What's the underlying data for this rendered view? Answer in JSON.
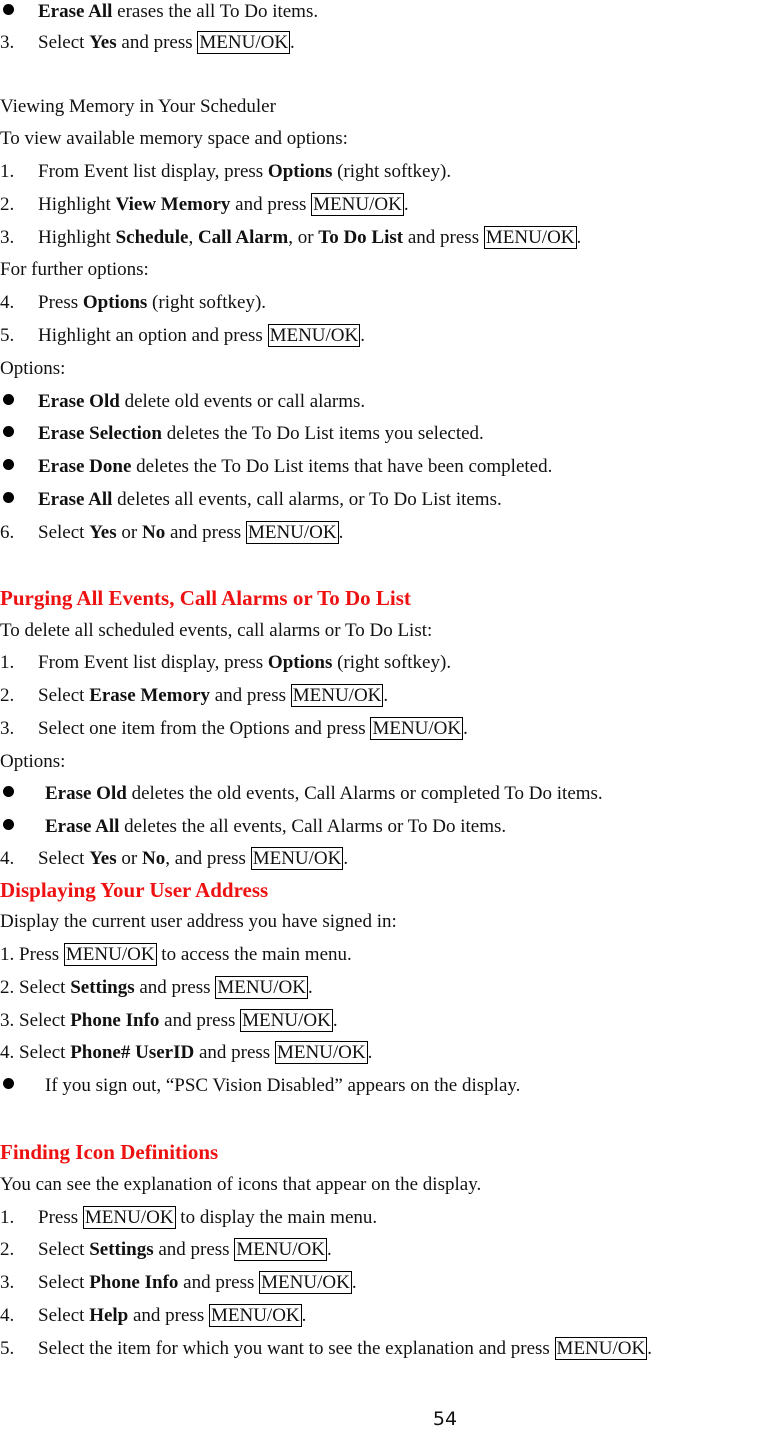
{
  "key_label": "MENU/OK",
  "top": {
    "bullet_erase_all": {
      "bold": "Erase All",
      "text": " erases the all To Do items."
    },
    "step3": {
      "num": "3.",
      "pre": "Select ",
      "bold": "Yes",
      "mid": " and press ",
      "post": "."
    }
  },
  "viewing": {
    "title": "Viewing Memory in Your Scheduler",
    "intro": "To view available memory space and options:",
    "step1": {
      "num": "1.",
      "pre": "From Event list display, press ",
      "bold": "Options",
      "post": " (right softkey)."
    },
    "step2": {
      "num": "2.",
      "pre": "Highlight ",
      "bold": "View Memory",
      "mid": " and press ",
      "post": "."
    },
    "step3": {
      "num": "3.",
      "pre": "Highlight ",
      "bold1": "Schedule",
      "sep1": ", ",
      "bold2": "Call Alarm",
      "sep2": ", or ",
      "bold3": "To Do List",
      "mid": " and press ",
      "post": "."
    },
    "further": "For further options:",
    "step4": {
      "num": "4.",
      "pre": "Press ",
      "bold": "Options",
      "post": " (right softkey)."
    },
    "step5": {
      "num": "5.",
      "pre": "Highlight an option and press ",
      "post": "."
    },
    "options_label": "Options:",
    "options": [
      {
        "bold": "Erase Old",
        "text": " delete old events or call alarms."
      },
      {
        "bold": "Erase Selection",
        "text": " deletes the To Do List items you selected."
      },
      {
        "bold": "Erase Done",
        "text": " deletes the To Do List items that have been completed."
      },
      {
        "bold": "Erase All",
        "text": " deletes all events, call alarms, or To Do List items."
      }
    ],
    "step6": {
      "num": "6.",
      "pre": "Select ",
      "bold1": "Yes",
      "sep": " or ",
      "bold2": "No",
      "mid": " and press ",
      "post": "."
    }
  },
  "purging": {
    "title": "Purging All Events, Call Alarms or To Do List",
    "intro": "To delete all scheduled events, call alarms or To Do List:",
    "step1": {
      "num": "1.",
      "pre": "From Event list display, press ",
      "bold": "Options",
      "post": " (right softkey)."
    },
    "step2": {
      "num": "2.",
      "pre": "Select ",
      "bold": "Erase Memory",
      "mid": " and press ",
      "post": "."
    },
    "step3": {
      "num": "3.",
      "pre": "Select one item from the Options and press ",
      "post": "."
    },
    "options_label": "Options:",
    "options": [
      {
        "bold": "Erase Old",
        "text": " deletes the old events, Call Alarms or completed To Do items."
      },
      {
        "bold": "Erase All",
        "text": " deletes the all events, Call Alarms or To Do items."
      }
    ],
    "step4": {
      "num": "4.",
      "pre": "Select ",
      "bold1": "Yes",
      "sep": " or ",
      "bold2": "No",
      "mid": ", and press ",
      "post": "."
    }
  },
  "user_address": {
    "title": "Displaying Your User Address",
    "intro": "Display the current user address you have signed in:",
    "step1": {
      "num": "1. ",
      "pre": "Press ",
      "post": " to access the main menu."
    },
    "step2": {
      "num": "2. ",
      "pre": "Select ",
      "bold": "Settings",
      "mid": " and press ",
      "post": "."
    },
    "step3": {
      "num": "3. ",
      "pre": "Select ",
      "bold": "Phone Info",
      "mid": " and press ",
      "post": "."
    },
    "step4": {
      "num": "4. ",
      "pre": "Select ",
      "bold": "Phone# UserID",
      "mid": " and press ",
      "post": "."
    },
    "note": "If you sign out, “PSC Vision Disabled” appears on the display."
  },
  "icon_defs": {
    "title": "Finding Icon Definitions",
    "intro": "You can see the explanation of icons that appear on the display.",
    "step1": {
      "num": "1.",
      "pre": "Press ",
      "post": " to display the main menu."
    },
    "step2": {
      "num": "2.",
      "pre": "Select ",
      "bold": "Settings",
      "mid": " and press ",
      "post": "."
    },
    "step3": {
      "num": "3.",
      "pre": "Select ",
      "bold": "Phone Info",
      "mid": " and press ",
      "post": "."
    },
    "step4": {
      "num": "4.",
      "pre": "Select ",
      "bold": "Help",
      "mid": " and press ",
      "post": "."
    },
    "step5": {
      "num": "5.",
      "pre": "Select the item for which you want to see the explanation and press ",
      "post": "."
    }
  },
  "page_number": "54"
}
